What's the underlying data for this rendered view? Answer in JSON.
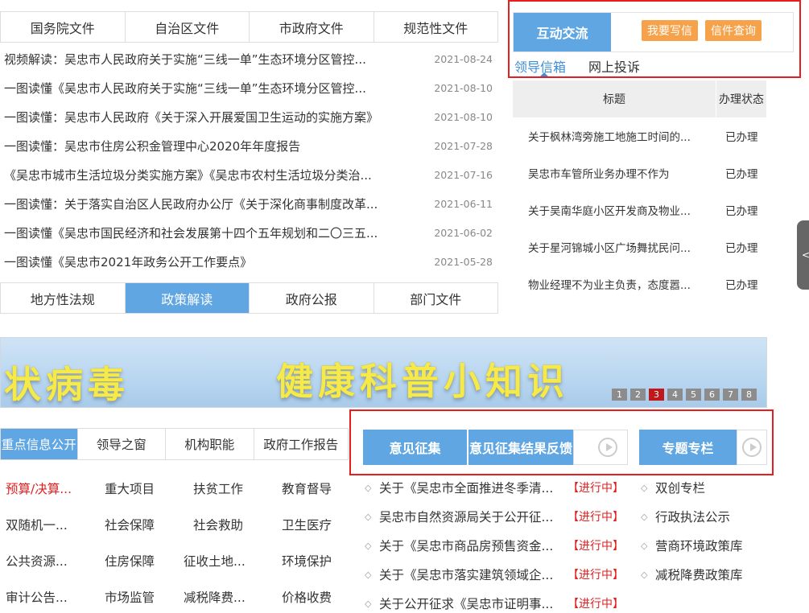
{
  "top_tabs": [
    "国务院文件",
    "自治区文件",
    "市政府文件",
    "规范性文件"
  ],
  "news": [
    {
      "title": "视频解读：吴忠市人民政府关于实施“三线一单”生态环境分区管控...",
      "date": "2021-08-24"
    },
    {
      "title": "一图读懂《吴忠市人民政府关于实施“三线一单”生态环境分区管控...",
      "date": "2021-08-10"
    },
    {
      "title": "一图读懂：吴忠市人民政府《关于深入开展爱国卫生运动的实施方案》",
      "date": "2021-08-10"
    },
    {
      "title": "一图读懂：吴忠市住房公积金管理中心2020年年度报告",
      "date": "2021-07-28"
    },
    {
      "title": "《吴忠市城市生活垃圾分类实施方案》《吴忠市农村生活垃圾分类治...",
      "date": "2021-07-16"
    },
    {
      "title": "一图读懂：关于落实自治区人民政府办公厅《关于深化商事制度改革...",
      "date": "2021-06-11"
    },
    {
      "title": "一图读懂《吴忠市国民经济和社会发展第十四个五年规划和二〇三五...",
      "date": "2021-06-02"
    },
    {
      "title": "一图读懂《吴忠市2021年政务公开工作要点》",
      "date": "2021-05-28"
    }
  ],
  "bottom_tabs": [
    "地方性法规",
    "政策解读",
    "政府公报",
    "部门文件"
  ],
  "interact": {
    "title": "互动交流",
    "write_btn": "我要写信",
    "query_btn": "信件查询",
    "sub_tabs": [
      "领导信箱",
      "网上投诉"
    ]
  },
  "letters": {
    "col_title": "标题",
    "col_status": "办理状态",
    "rows": [
      {
        "title": "关于枫林湾旁施工地施工时间的...",
        "status": "已办理"
      },
      {
        "title": "吴忠市车管所业务办理不作为",
        "status": "已办理"
      },
      {
        "title": "关于吴南华庭小区开发商及物业...",
        "status": "已办理"
      },
      {
        "title": "关于星河锦城小区广场舞扰民问...",
        "status": "已办理"
      },
      {
        "title": "物业经理不为业主负责，态度嚣...",
        "status": "已办理"
      }
    ]
  },
  "side_handle": "<",
  "banner": {
    "left_text": "状病毒",
    "right_text": "健康科普小知识",
    "pages": [
      "1",
      "2",
      "3",
      "4",
      "5",
      "6",
      "7",
      "8"
    ],
    "active_page": "3"
  },
  "info_tabs": [
    "重点信息公开",
    "领导之窗",
    "机构职能",
    "政府工作报告"
  ],
  "info_grid": [
    [
      "预算/决算...",
      "重大项目",
      "扶贫工作",
      "教育督导"
    ],
    [
      "双随机一...",
      "社会保障",
      "社会救助",
      "卫生医疗"
    ],
    [
      "公共资源...",
      "住房保障",
      "征收土地...",
      "环境保护"
    ],
    [
      "审计公告...",
      "市场监管",
      "减税降费...",
      "价格收费"
    ]
  ],
  "opinion": {
    "btn1": "意见征集",
    "btn2": "意见征集结果反馈",
    "btn3": "专题专栏"
  },
  "opinion_rows": [
    {
      "title": "关于《吴忠市全面推进冬季清...",
      "status": "【进行中】"
    },
    {
      "title": "吴忠市自然资源局关于公开征...",
      "status": "【进行中】"
    },
    {
      "title": "关于《吴忠市商品房预售资金...",
      "status": "【进行中】"
    },
    {
      "title": "关于《吴忠市落实建筑领域企...",
      "status": "【进行中】"
    },
    {
      "title": "关于公开征求《吴忠市证明事...",
      "status": "【进行中】"
    }
  ],
  "special_rows": [
    "双创专栏",
    "行政执法公示",
    "营商环境政策库",
    "减税降费政策库"
  ],
  "colors": {
    "accent": "#5fa6e2",
    "highlight_border": "#e61e1e",
    "orange": "#f6a24a",
    "status_red": "#e02020"
  }
}
